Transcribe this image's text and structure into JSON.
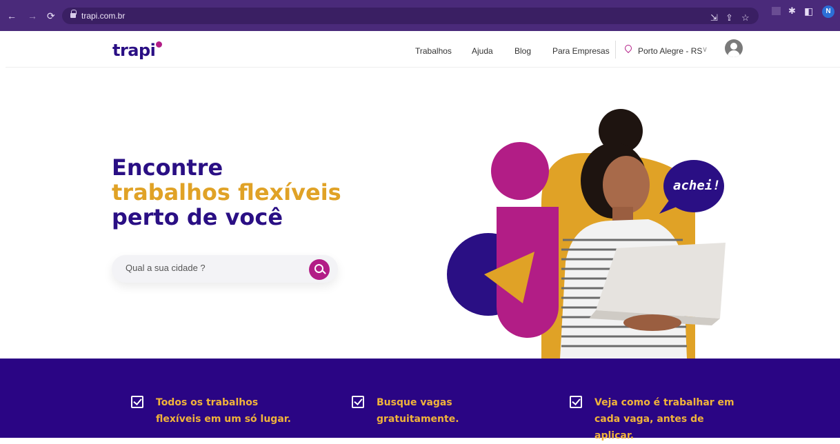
{
  "browser": {
    "url": "trapi.com.br",
    "profile_initial": "N",
    "accent": "#4a2a7a"
  },
  "header": {
    "logo": "trapi",
    "nav": [
      "Trabalhos",
      "Ajuda",
      "Blog",
      "Para Empresas"
    ],
    "city": "Porto Alegre - RS"
  },
  "hero": {
    "title_line1": "Encontre",
    "title_line2": "trabalhos flexíveis",
    "title_line3": "perto de você",
    "search_placeholder": "Qual a sua cidade ?",
    "bubble": "achei!"
  },
  "features": [
    {
      "line1": "Todos os trabalhos",
      "line2": "flexíveis em um só lugar."
    },
    {
      "line1": "Busque vagas",
      "line2": "gratuitamente."
    },
    {
      "line1": "Veja como é trabalhar em",
      "line2": "cada vaga, antes de aplicar."
    }
  ],
  "colors": {
    "primary": "#2a0f84",
    "accent": "#e0a226",
    "magenta": "#b21d86",
    "banner": "#2a0584"
  }
}
